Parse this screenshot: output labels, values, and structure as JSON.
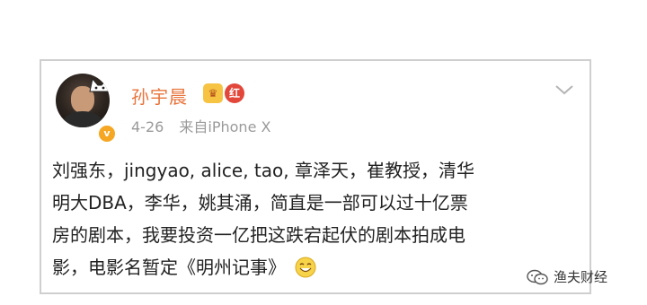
{
  "post": {
    "username": "孙宇晨",
    "badges": {
      "crown_glyph": "♛",
      "red_badge_label": "红"
    },
    "verified_glyph": "v",
    "date": "4-26",
    "source": "来自iPhone X",
    "content": {
      "line1": "刘强东，jingyao, alice, tao, 章泽天，崔教授，清华",
      "line2": "明大DBA，李华，姚其涌，简直是一部可以过十亿票",
      "line3": "房的剧本，我要投资一亿把这跌宕起伏的剧本拍成电",
      "line4": "影，电影名暂定《明州记事》"
    },
    "icons": {
      "avatar": "avatar-image",
      "verified": "verified-badge-icon",
      "crown": "crown-badge-icon",
      "red_badge": "red-badge-icon",
      "chevron": "chevron-down-icon",
      "emoji": "smile-emoji-icon"
    }
  },
  "watermark": {
    "text": "渔夫财经",
    "icon": "wechat-icon"
  },
  "colors": {
    "username": "#e8743b",
    "meta": "#9a9a9a",
    "border": "#cfcfcf"
  }
}
